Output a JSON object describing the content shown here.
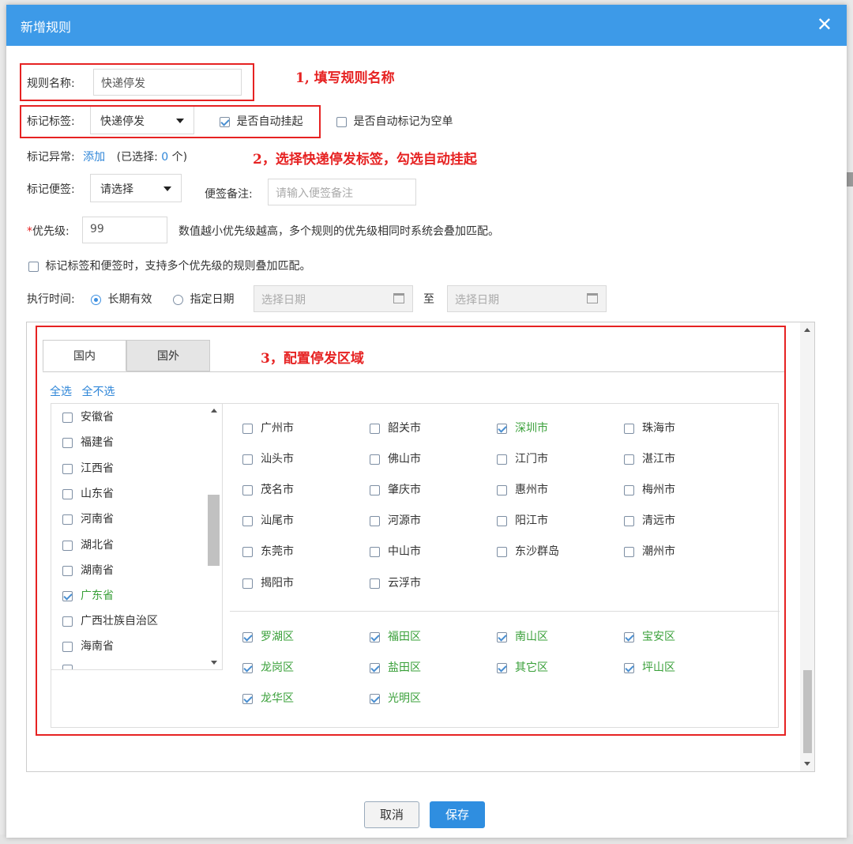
{
  "dialog": {
    "title": "新增规则",
    "close_glyph": "✕"
  },
  "form": {
    "rule_name_label": "规则名称:",
    "rule_name_value": "快递停发",
    "tag_label": "标记标签:",
    "tag_selected": "快递停发",
    "auto_hang_label": "是否自动挂起",
    "auto_hang_checked": true,
    "auto_empty_label": "是否自动标记为空单",
    "auto_empty_checked": false,
    "exception_label": "标记异常:",
    "exception_add": "添加",
    "exception_selected_prefix": "(已选择:",
    "exception_selected_count": "0",
    "exception_selected_suffix": "个)",
    "note_tag_label": "标记便签:",
    "note_tag_selected": "请选择",
    "note_remark_label": "便签备注:",
    "note_remark_placeholder": "请输入便签备注",
    "priority_star": "*",
    "priority_label": "优先级:",
    "priority_value": "99",
    "priority_hint": "数值越小优先级越高，多个规则的优先级相同时系统会叠加匹配。",
    "stack_option_label": "标记标签和便签时，支持多个优先级的规则叠加匹配。",
    "exec_time_label": "执行时间:",
    "radio_long_term": "长期有效",
    "radio_specified": "指定日期",
    "date_start_placeholder": "选择日期",
    "date_to": "至",
    "date_end_placeholder": "选择日期"
  },
  "annotations": {
    "step1": "1, 填写规则名称",
    "step2": "2，选择快递停发标签，勾选自动挂起",
    "step3": "3，配置停发区域"
  },
  "region": {
    "tabs": [
      "国内",
      "国外"
    ],
    "select_all": "全选",
    "select_none": "全不选",
    "provinces": [
      {
        "name": "安徽省",
        "checked": false
      },
      {
        "name": "福建省",
        "checked": false
      },
      {
        "name": "江西省",
        "checked": false
      },
      {
        "name": "山东省",
        "checked": false
      },
      {
        "name": "河南省",
        "checked": false
      },
      {
        "name": "湖北省",
        "checked": false
      },
      {
        "name": "湖南省",
        "checked": false
      },
      {
        "name": "广东省",
        "checked": true
      },
      {
        "name": "广西壮族自治区",
        "checked": false
      },
      {
        "name": "海南省",
        "checked": false
      }
    ],
    "cities": [
      {
        "name": "广州市",
        "checked": false
      },
      {
        "name": "韶关市",
        "checked": false
      },
      {
        "name": "深圳市",
        "checked": true
      },
      {
        "name": "珠海市",
        "checked": false
      },
      {
        "name": "汕头市",
        "checked": false
      },
      {
        "name": "佛山市",
        "checked": false
      },
      {
        "name": "江门市",
        "checked": false
      },
      {
        "name": "湛江市",
        "checked": false
      },
      {
        "name": "茂名市",
        "checked": false
      },
      {
        "name": "肇庆市",
        "checked": false
      },
      {
        "name": "惠州市",
        "checked": false
      },
      {
        "name": "梅州市",
        "checked": false
      },
      {
        "name": "汕尾市",
        "checked": false
      },
      {
        "name": "河源市",
        "checked": false
      },
      {
        "name": "阳江市",
        "checked": false
      },
      {
        "name": "清远市",
        "checked": false
      },
      {
        "name": "东莞市",
        "checked": false
      },
      {
        "name": "中山市",
        "checked": false
      },
      {
        "name": "东沙群岛",
        "checked": false
      },
      {
        "name": "潮州市",
        "checked": false
      },
      {
        "name": "揭阳市",
        "checked": false
      },
      {
        "name": "云浮市",
        "checked": false
      }
    ],
    "districts": [
      {
        "name": "罗湖区",
        "checked": true
      },
      {
        "name": "福田区",
        "checked": true
      },
      {
        "name": "南山区",
        "checked": true
      },
      {
        "name": "宝安区",
        "checked": true
      },
      {
        "name": "龙岗区",
        "checked": true
      },
      {
        "name": "盐田区",
        "checked": true
      },
      {
        "name": "其它区",
        "checked": true
      },
      {
        "name": "坪山区",
        "checked": true
      },
      {
        "name": "龙华区",
        "checked": true
      },
      {
        "name": "光明区",
        "checked": true
      }
    ]
  },
  "footer": {
    "cancel_label": "取消",
    "save_label": "保存"
  },
  "colors": {
    "titlebar": "#3d9ae8",
    "annotation_red": "#e62222",
    "checked_green": "#3aa03a",
    "link_blue": "#2f86d8",
    "save_button": "#2f8ee0"
  }
}
